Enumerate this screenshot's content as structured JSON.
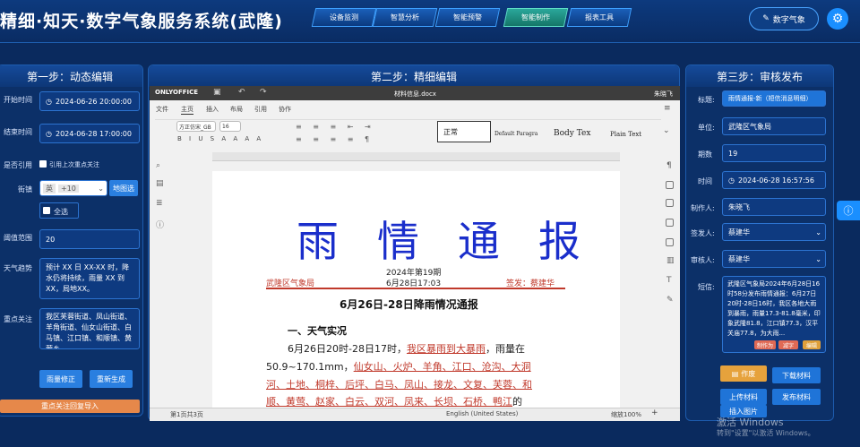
{
  "header": {
    "title": "精细·知天·数字气象服务系统(武隆)",
    "nav": [
      "设备监测",
      "智慧分析",
      "智能预警",
      "智能制作",
      "报表工具"
    ],
    "active_index": 3,
    "shuzi_button": "数字气象"
  },
  "left": {
    "title": "第一步：动态编辑",
    "start_label": "开始时间",
    "start_value": "2024-06-26 20:00:00",
    "end_label": "结束时间",
    "end_value": "2024-06-28 17:00:00",
    "ref_label": "是否引用",
    "ref_option": "引用上次重点关注",
    "street_label": "街镇",
    "street_tag": "英",
    "street_tag2": "+10",
    "street_btn": "地图选",
    "all_label": "全选",
    "threshold_label": "阈值范围",
    "threshold_value": "20",
    "trend_label": "天气趋势",
    "trend_text": "预计 XX 日 XX-XX 时，降水仍将持续，雨量 XX 到 XX，局地XX。",
    "focus_label": "重点关注",
    "focus_text": "我区芙蓉街道、凤山街道、羊角街道、仙女山街道、白马镇、江口镇、和顺镇、黄莺乡",
    "btn_verify": "雨量修正",
    "btn_regen": "重新生成",
    "btn_import": "重点关注回复导入"
  },
  "mid": {
    "title": "第二步：精细编辑",
    "app": "ONLYOFFICE",
    "file": "材料信息.docx",
    "user": "朱晓飞",
    "menus": [
      "文件",
      "主页",
      "插入",
      "布局",
      "引用",
      "协作"
    ],
    "active_menu": 1,
    "font": "方正仿宋_GB",
    "size": "16",
    "styles": [
      "正常",
      "Default Paragra",
      "Body Tex",
      "Plain Text"
    ],
    "page": "第1页共3页",
    "lang": "English (United States)",
    "zoom": "缩放100%"
  },
  "doc": {
    "heading": "雨 情 通 报",
    "issue": "2024年第19期",
    "org": "武隆区气象局",
    "date": "6月28日17:03",
    "signer": "签发：蔡建华",
    "subtitle": "6月26日-28日降雨情况通报",
    "section": "一、天气实况",
    "p1a": "6月26日20时-28日17时，",
    "p1b": "我区暴雨到大暴雨",
    "p1c": "，雨量在",
    "p2a": "50.9~170.1mm，",
    "p2b": "仙女山、火炉、羊角、江口、沧沟、大洞",
    "p3": "河、土地、桐梓、后坪、白马、凤山、接龙、文复、芙蓉、和",
    "p4a": "顺、黄莺、赵家、白云、双河、凤来、长坝、石桥、鸭江",
    "p4b": "的"
  },
  "right": {
    "title": "第三步：审核发布",
    "t_label": "标题:",
    "t_value": "雨情通报-新（短信消息明细）",
    "unit_label": "单位:",
    "unit_value": "武隆区气象局",
    "issue_label": "期数",
    "issue_value": "19",
    "time_label": "时间",
    "time_value": "2024-06-28 16:57:56",
    "maker_label": "制作人:",
    "maker_value": "朱晓飞",
    "signer_label": "签发人:",
    "signer_value": "蔡建华",
    "reviewer_label": "审核人:",
    "reviewer_value": "蔡建华",
    "sms_label": "短信:",
    "sms_text": "武隆区气象局2024年6月28日16时58分发布雨情通报：6月27日20时-28日16时，我区各地大雨到暴雨，雨量17.3-81.8毫米，印象武隆81.8，江口镇77.3，汉平关庙77.8，为大雨...",
    "tag1": "制作为",
    "tag2": "减字",
    "tag3": "编辑",
    "btn_void": "作废",
    "btn_down": "下载材料",
    "btn_upload": "上传材料",
    "btn_publish": "发布材料",
    "btn_img": "插入图片"
  },
  "watermark": {
    "line1": "激活 Windows",
    "line2": "转到\"设置\"以激活 Windows。"
  }
}
